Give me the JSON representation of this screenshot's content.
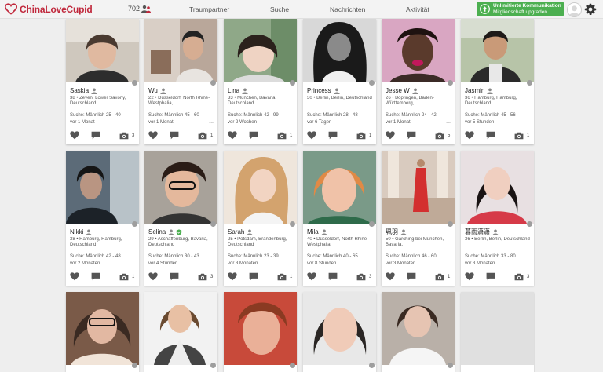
{
  "header": {
    "logo_text": "ChinaLoveCupid",
    "count": "702",
    "nav": [
      "Traumpartner",
      "Suche",
      "Nachrichten",
      "Aktivität"
    ],
    "upgrade_line1": "Unlimitierte Kommunikation",
    "upgrade_line2": "Mitgliedschaft upgraden"
  },
  "colors": {
    "brand": "#c0283c",
    "upgrade": "#4caf50",
    "online_dot": "#9e9e9e"
  },
  "profiles_row1": [
    {
      "name": "Saskia",
      "location": "38 • Zeven, Lower Saxony, Deutschland",
      "search": "Suche: Männlich 25 - 40",
      "ago": "vor 1 Monat",
      "photos": "3",
      "more": false
    },
    {
      "name": "Wu",
      "location": "22 • Düsseldorf, North Rhine-Westphalia,",
      "search": "Suche: Männlich 45 - 60",
      "ago": "vor 1 Monat",
      "photos": "1",
      "more": true
    },
    {
      "name": "Lina",
      "location": "33 • München, Bavaria, Deutschland",
      "search": "Suche: Männlich 42 - 99",
      "ago": "vor 2 Wochen",
      "photos": "1",
      "more": false
    },
    {
      "name": "Princess",
      "location": "30 • Berlin, Berlin, Deutschland",
      "search": "Suche: Männlich 28 - 48",
      "ago": "vor 6 Tagen",
      "photos": "1",
      "more": false
    },
    {
      "name": "Jesse W",
      "location": "26 • Bopfingen, Baden-Württemberg,",
      "search": "Suche: Männlich 24 - 42",
      "ago": "vor 1 Monat",
      "photos": "5",
      "more": true
    },
    {
      "name": "Jasmin",
      "location": "36 • Hamburg, Hamburg, Deutschland",
      "search": "Suche: Männlich 45 - 56",
      "ago": "vor 5 Stunden",
      "photos": "1",
      "more": false
    }
  ],
  "profiles_row2": [
    {
      "name": "Nikki",
      "location": "38 • Hamburg, Hamburg, Deutschland",
      "search": "Suche: Männlich 42 - 48",
      "ago": "vor 2 Monaten",
      "photos": "1",
      "verified": false,
      "more": false
    },
    {
      "name": "Selina",
      "location": "29 • Aschaffenburg, Bavaria, Deutschland",
      "search": "Suche: Männlich 30 - 43",
      "ago": "vor 4 Stunden",
      "photos": "3",
      "verified": true,
      "more": false
    },
    {
      "name": "Sarah",
      "location": "25 • Potsdam, Brandenburg, Deutschland",
      "search": "Suche: Männlich 23 - 39",
      "ago": "vor 3 Monaten",
      "photos": "1",
      "verified": false,
      "more": false
    },
    {
      "name": "Mila",
      "location": "40 • Düsseldorf, North Rhine-Westphalia,",
      "search": "Suche: Männlich 40 - 65",
      "ago": "vor 8 Stunden",
      "photos": "3",
      "verified": false,
      "more": true
    },
    {
      "name": "珮羽",
      "location": "50 • Garching bei München, Bavaria,",
      "search": "Suche: Männlich 46 - 60",
      "ago": "vor 3 Monaten",
      "photos": "1",
      "verified": false,
      "more": true
    },
    {
      "name": "暮雨潇潇",
      "location": "36 • Berlin, Berlin, Deutschland",
      "search": "Suche: Männlich 33 - 80",
      "ago": "vor 3 Monaten",
      "photos": "3",
      "verified": false,
      "more": false
    }
  ]
}
